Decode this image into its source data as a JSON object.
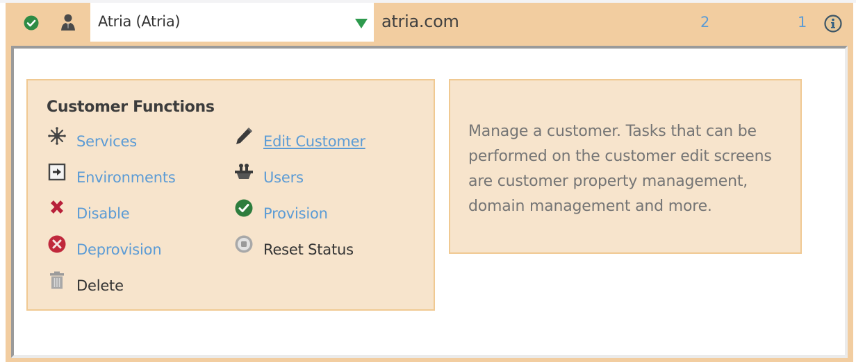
{
  "header": {
    "status": "active",
    "customer_select": {
      "selected": "Atria (Atria)"
    },
    "domain": "atria.com",
    "count_a": "2",
    "count_b": "1"
  },
  "functions": {
    "title": "Customer Functions",
    "items": [
      {
        "label": "Services",
        "icon": "services-icon",
        "style": "link"
      },
      {
        "label": "Edit Customer",
        "icon": "pencil-icon",
        "style": "link-underlined"
      },
      {
        "label": "Environments",
        "icon": "environment-arrow-icon",
        "style": "link"
      },
      {
        "label": "Users",
        "icon": "users-icon",
        "style": "link"
      },
      {
        "label": "Disable",
        "icon": "x-icon",
        "style": "link"
      },
      {
        "label": "Provision",
        "icon": "check-circle-icon",
        "style": "link"
      },
      {
        "label": "Deprovision",
        "icon": "x-circle-icon",
        "style": "link"
      },
      {
        "label": "Reset Status",
        "icon": "stop-circle-icon",
        "style": "plain"
      },
      {
        "label": "Delete",
        "icon": "trash-icon",
        "style": "plain"
      }
    ]
  },
  "description": "Manage a customer. Tasks that can be performed on the customer edit screens are customer property management, domain management and more.",
  "colors": {
    "row_background": "#f2cda0",
    "card_background": "#f7e4cc",
    "card_border": "#f0c992",
    "link": "#5b9bd5",
    "success": "#2e8b45",
    "danger": "#c0283c"
  }
}
